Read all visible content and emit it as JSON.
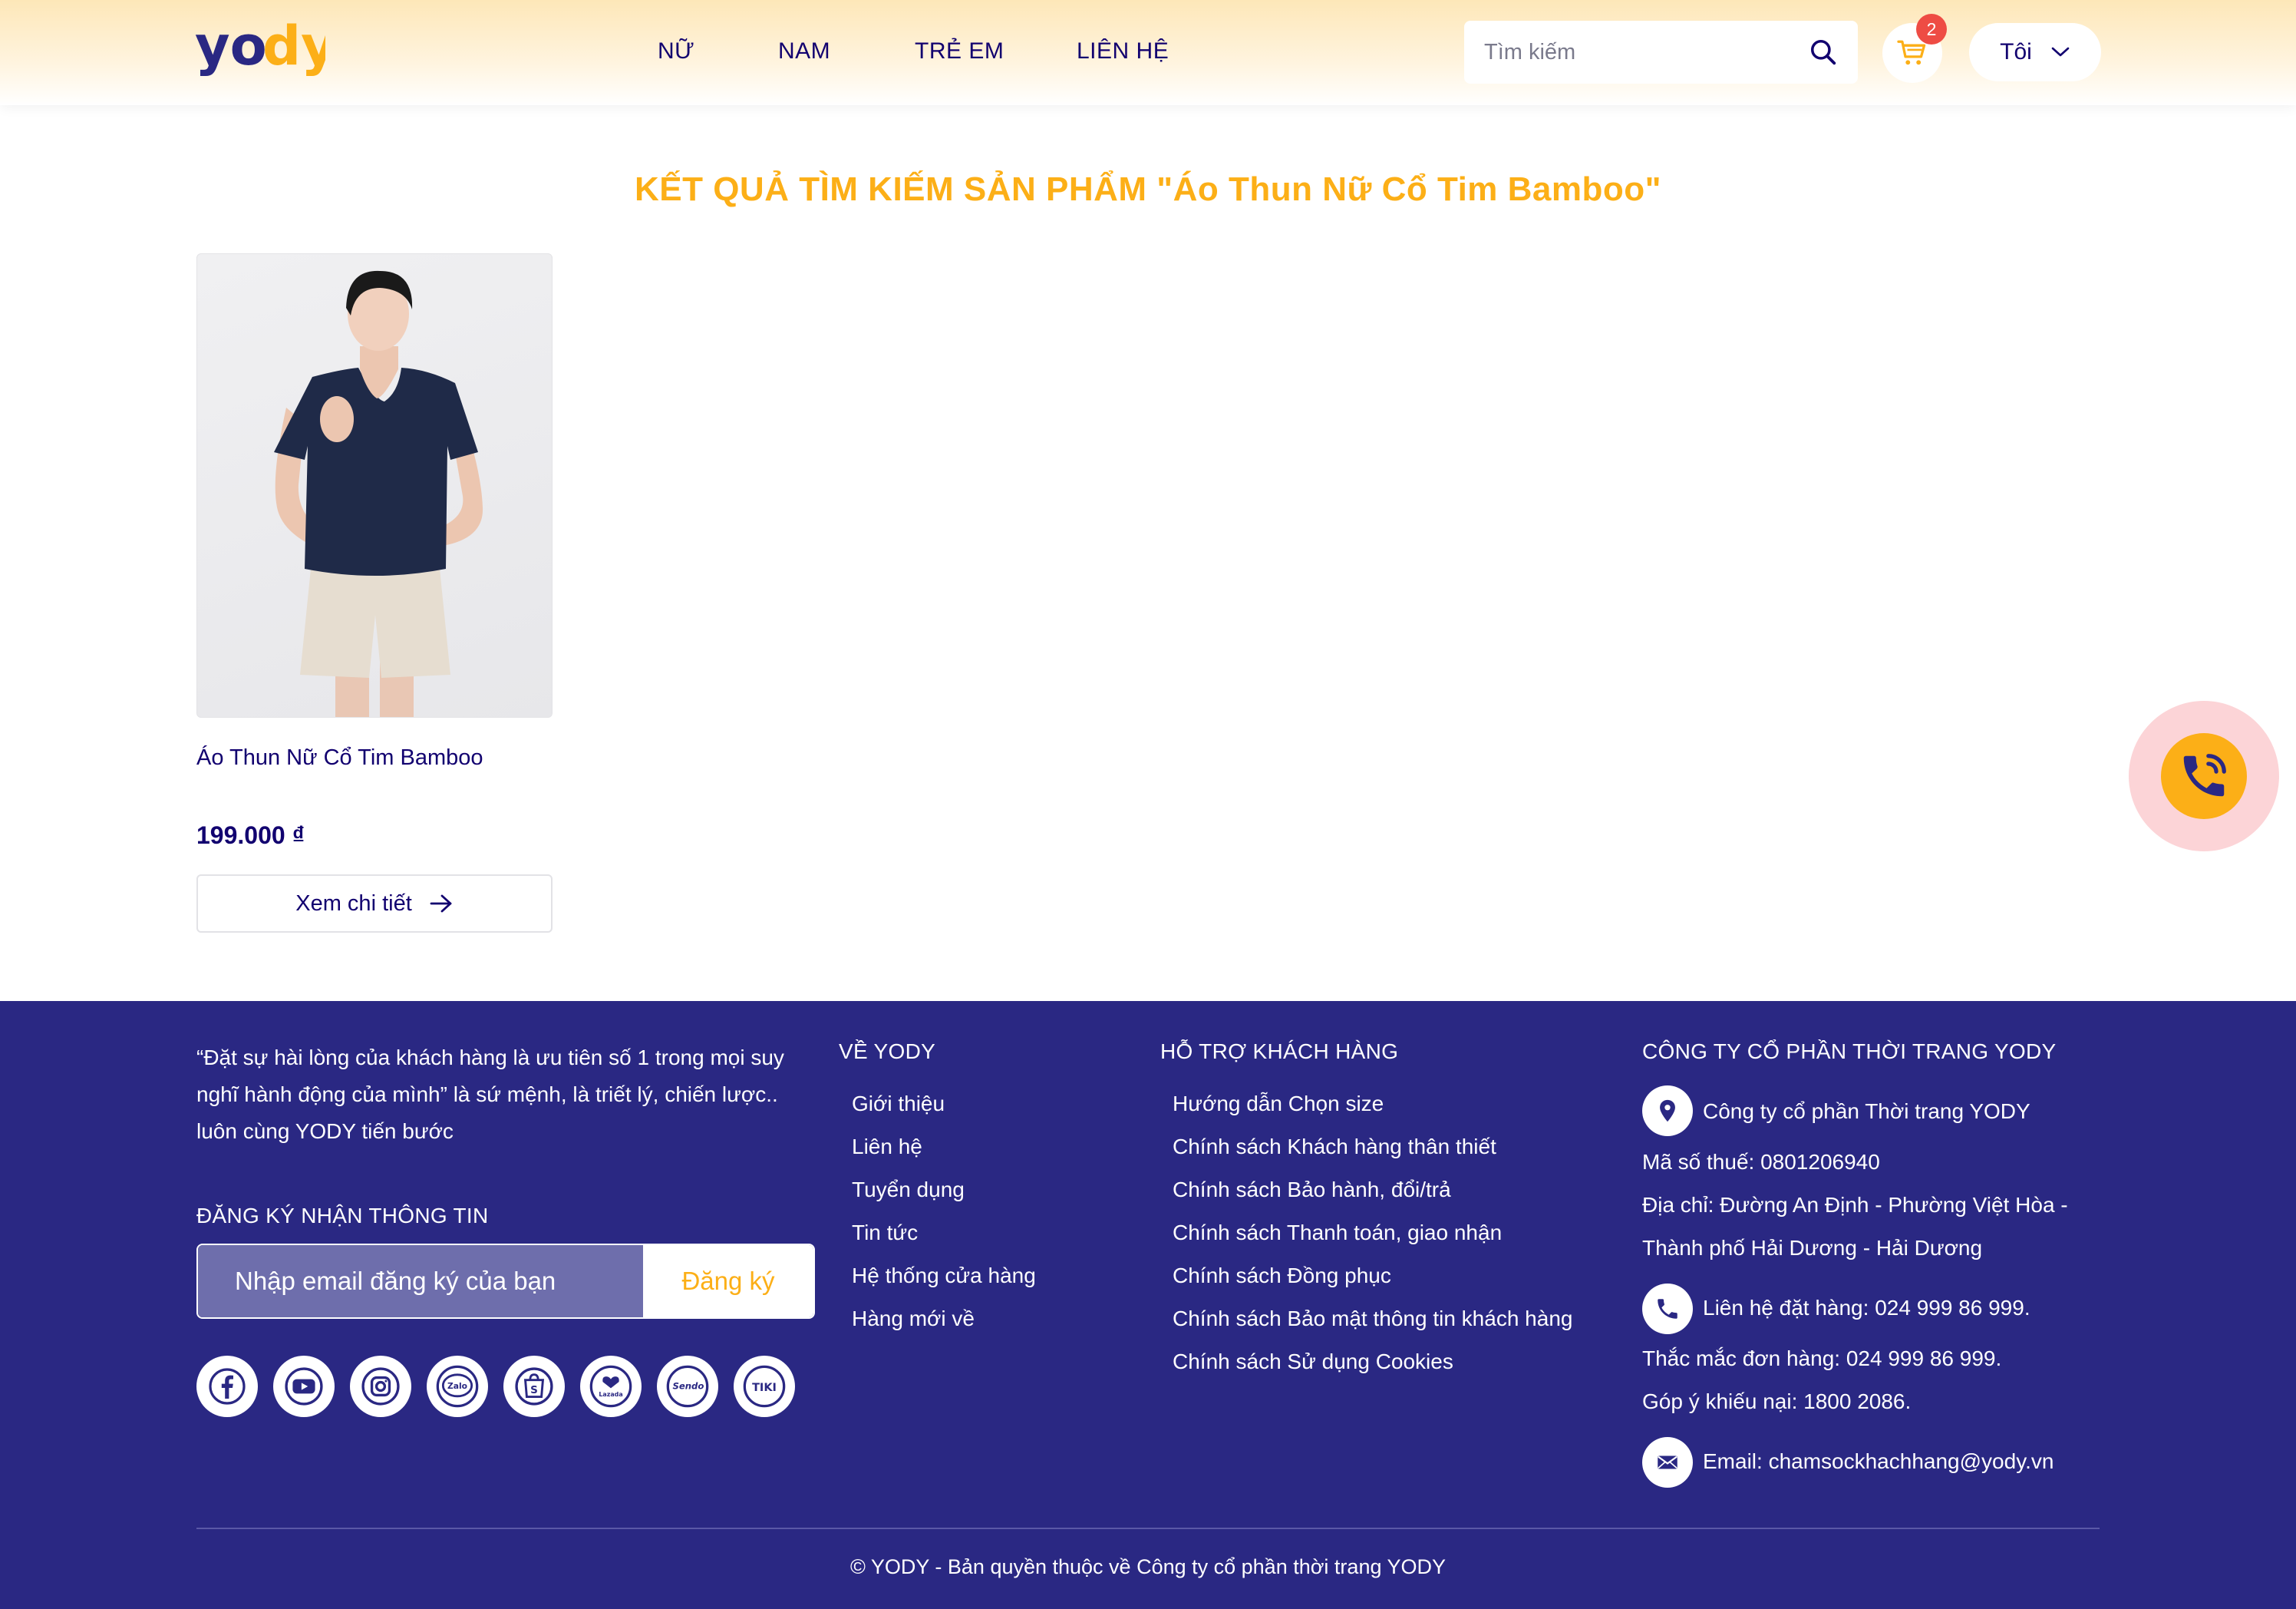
{
  "header": {
    "logo_text": "yody",
    "nav": [
      {
        "label": "NỮ"
      },
      {
        "label": "NAM"
      },
      {
        "label": "TRẺ EM"
      },
      {
        "label": "LIÊN HỆ"
      }
    ],
    "search": {
      "placeholder": "Tìm kiếm",
      "value": ""
    },
    "cart": {
      "count": "2",
      "icon": "cart-icon"
    },
    "account": {
      "label": "Tôi",
      "icon": "chevron-down-icon"
    }
  },
  "main": {
    "title": "KẾT QUẢ TÌM KIẾM SẢN PHẨM \"Áo Thun Nữ Cổ Tim Bamboo\"",
    "products": [
      {
        "name": "Áo Thun Nữ Cổ Tim Bamboo",
        "price": "199.000 ₫",
        "button_label": "Xem chi tiết"
      }
    ]
  },
  "footer": {
    "mission": "“Đặt sự hài lòng của khách hàng là ưu tiên số 1 trong mọi suy nghĩ hành động của mình” là sứ mệnh, là triết lý, chiến lược.. luôn cùng YODY tiến bước",
    "subscribe": {
      "heading": "ĐĂNG KÝ NHẬN THÔNG TIN",
      "placeholder": "Nhập email đăng ký của bạn",
      "button": "Đăng ký"
    },
    "socials": [
      "facebook",
      "youtube",
      "instagram",
      "Zalo",
      "shopee",
      "Lazada",
      "Sendo",
      "TIKI"
    ],
    "about": {
      "heading": "VỀ YODY",
      "links": [
        "Giới thiệu",
        "Liên hệ",
        "Tuyển dụng",
        "Tin tức",
        "Hệ thống cửa hàng",
        "Hàng mới về"
      ]
    },
    "support": {
      "heading": "HỖ TRỢ KHÁCH HÀNG",
      "links": [
        "Hướng dẫn Chọn size",
        "Chính sách Khách hàng thân thiết",
        "Chính sách Bảo hành, đổi/trả",
        "Chính sách Thanh toán, giao nhận",
        "Chính sách Đồng phục",
        "Chính sách Bảo mật thông tin khách hàng",
        "Chính sách Sử dụng Cookies"
      ]
    },
    "company": {
      "heading": "CÔNG TY CỔ PHẦN THỜI TRANG YODY",
      "name": "Công ty cổ phần Thời trang YODY",
      "tax": "Mã số thuế: 0801206940",
      "address_1": "Địa chỉ: Đường An Định - Phường Việt Hòa -",
      "address_2": "Thành phố Hải Dương - Hải Dương",
      "order_phone": "Liên hệ đặt hàng: 024 999 86 999.",
      "question_phone": "Thắc mắc đơn hàng: 024 999 86 999.",
      "complaint_phone": "Góp ý khiếu nại: 1800 2086.",
      "email": "Email: chamsockhachhang@yody.vn"
    },
    "copyright": "© YODY - Bản quyền thuộc về Công ty cổ phần thời trang YODY"
  },
  "colors": {
    "brand_navy": "#2a2883",
    "brand_yellow": "#fcaf17",
    "text_navy": "#11006f",
    "badge_red": "#ee4c44"
  }
}
